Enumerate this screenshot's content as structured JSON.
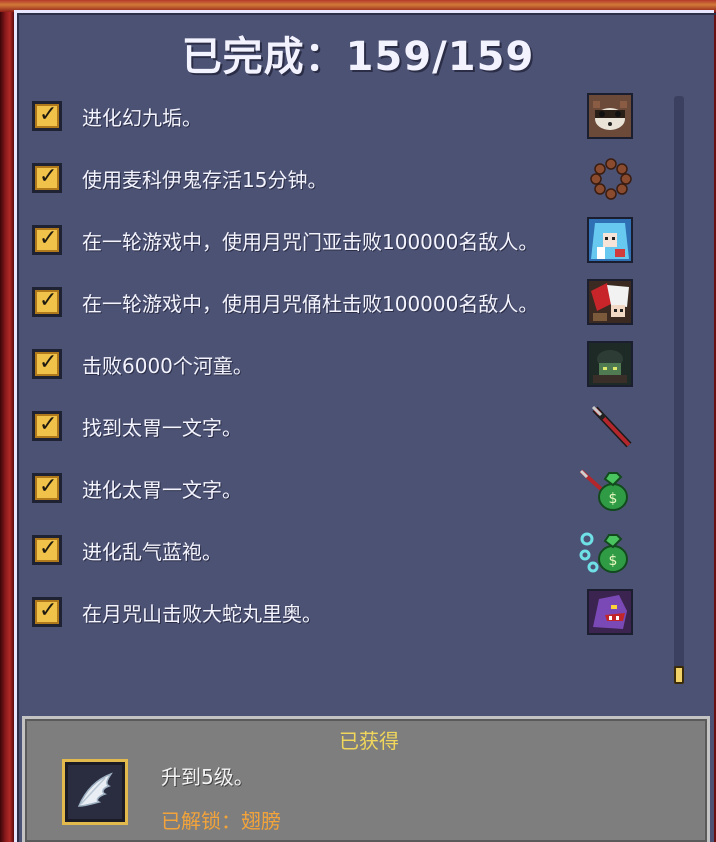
{
  "header": {
    "title": "已完成：159/159"
  },
  "achievements": [
    {
      "text": "进化幻九垢。",
      "icon": "raccoon-mask-icon"
    },
    {
      "text": "使用麦科伊鬼存活15分钟。",
      "icon": "prayer-beads-icon"
    },
    {
      "text": "在一轮游戏中，使用月咒门亚击败100000名敌人。",
      "icon": "blue-haired-character-icon"
    },
    {
      "text": "在一轮游戏中，使用月咒俑杜击败100000名敌人。",
      "icon": "red-white-haired-character-icon"
    },
    {
      "text": "击败6000个河童。",
      "icon": "kappa-icon"
    },
    {
      "text": "找到太胃一文字。",
      "icon": "katana-icon"
    },
    {
      "text": "进化太胃一文字。",
      "icon": "money-bag-sword-icon"
    },
    {
      "text": "进化乱气蓝袍。",
      "icon": "money-bag-bubbles-icon"
    },
    {
      "text": "在月咒山击败大蛇丸里奥。",
      "icon": "purple-serpent-icon"
    }
  ],
  "reward": {
    "status": "已获得",
    "description": "升到5级。",
    "unlocked": "已解锁：翅膀",
    "icon": "wing-icon"
  },
  "colors": {
    "panel": "#4c5274",
    "checkbox": "#f0c24a",
    "obtained": "#f0d65a",
    "unlocked": "#f2a33a"
  }
}
